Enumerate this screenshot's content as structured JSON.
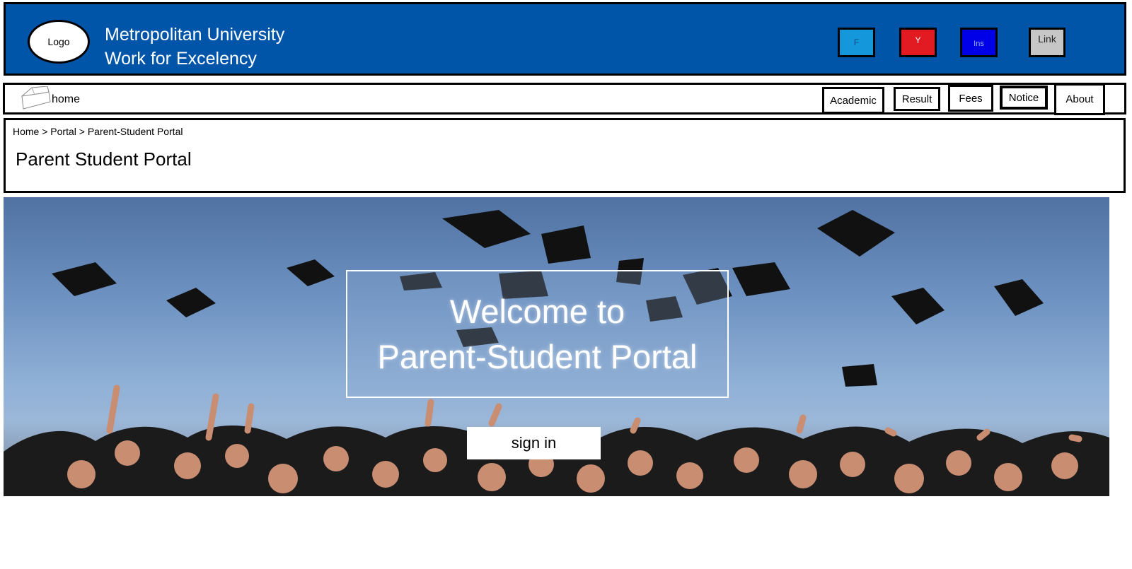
{
  "header": {
    "logo_label": "Logo",
    "university_name": "Metropolitan University",
    "tagline": "Work for Excelency",
    "background_color": "#0055a9",
    "social": [
      {
        "label": "F",
        "icon": "facebook-icon",
        "color": "#1497db"
      },
      {
        "label": "Y",
        "icon": "youtube-icon",
        "color": "#e21b22"
      },
      {
        "label": "Ins",
        "icon": "instagram-icon",
        "color": "#0000e8"
      },
      {
        "label": "Link",
        "icon": "linkedin-icon",
        "color": "#c6c6c6"
      }
    ]
  },
  "nav": {
    "home_icon": "home-icon",
    "home_label": "home",
    "items": [
      "Academic",
      "Result",
      "Fees",
      "Notice",
      "About"
    ]
  },
  "page": {
    "breadcrumb": "Home > Portal > Parent-Student Portal",
    "title": "Parent Student Portal"
  },
  "hero": {
    "welcome_line1": "Welcome to",
    "welcome_line2": "Parent-Student Portal",
    "signin_label": "sign in"
  }
}
